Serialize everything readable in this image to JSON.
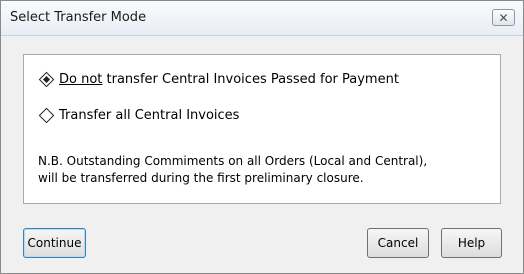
{
  "dialog": {
    "title": "Select Transfer Mode",
    "close_icon": "close-icon"
  },
  "options": [
    {
      "label_u": "Do not",
      "label_rest": " transfer Central Invoices Passed for Payment",
      "selected": true
    },
    {
      "label": "Transfer all Central Invoices",
      "selected": false
    }
  ],
  "note": {
    "line1": "N.B. Outstanding Commiments on all Orders (Local and Central),",
    "line2": "will be transferred during the first preliminary closure."
  },
  "buttons": {
    "continue": "Continue",
    "cancel": "Cancel",
    "help": "Help"
  }
}
